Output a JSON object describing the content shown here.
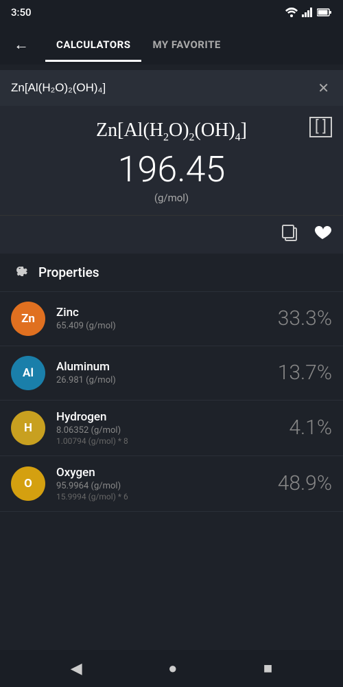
{
  "statusBar": {
    "time": "3:50"
  },
  "navigation": {
    "backLabel": "←",
    "tabs": [
      {
        "id": "calculators",
        "label": "CALCULATORS",
        "active": true
      },
      {
        "id": "my-favorite",
        "label": "MY FAVORITE",
        "active": false
      }
    ]
  },
  "search": {
    "value": "Zn[Al(H₂O)₂(OH)₄]",
    "clearLabel": "✕"
  },
  "formula": {
    "display": "Zn[Al(H₂O)₂(OH)₄]",
    "molarMass": "196.45",
    "unit": "(g/mol)",
    "expandIcon": "[ ]"
  },
  "actions": {
    "copyLabel": "⧉",
    "favoriteLabel": "♥"
  },
  "properties": {
    "title": "Properties",
    "gearIcon": "⚙"
  },
  "elements": [
    {
      "symbol": "Zn",
      "color": "#e07020",
      "name": "Zinc",
      "mass": "65.409 (g/mol)",
      "subMass": "",
      "percent": "33.3%"
    },
    {
      "symbol": "Al",
      "color": "#1a7faa",
      "name": "Aluminum",
      "mass": "26.981 (g/mol)",
      "subMass": "",
      "percent": "13.7%"
    },
    {
      "symbol": "H",
      "color": "#c8a020",
      "name": "Hydrogen",
      "mass": "8.06352 (g/mol)",
      "subMass": "1.00794 (g/mol) * 8",
      "percent": "4.1%"
    },
    {
      "symbol": "O",
      "color": "#d4a010",
      "name": "Oxygen",
      "mass": "95.9964 (g/mol)",
      "subMass": "15.9994 (g/mol) * 6",
      "percent": "48.9%"
    }
  ],
  "bottomNav": {
    "backIcon": "◀",
    "homeIcon": "●",
    "squareIcon": "■"
  }
}
